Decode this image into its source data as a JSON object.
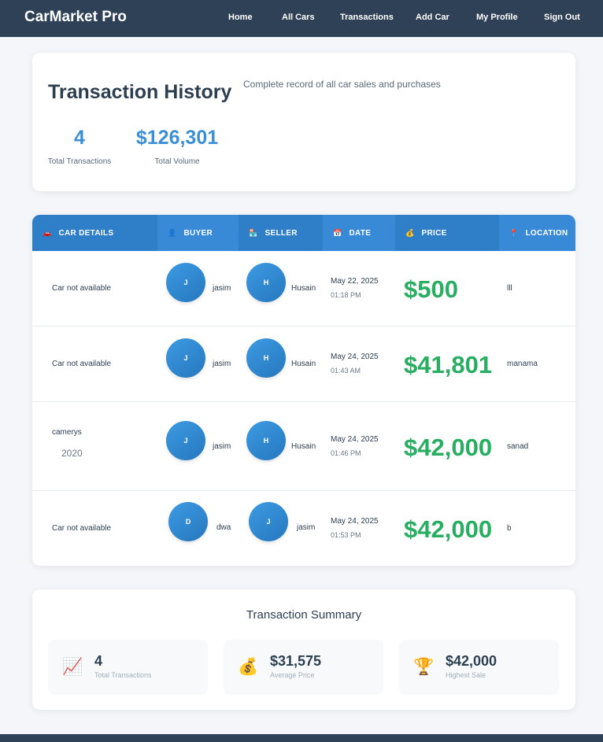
{
  "nav": {
    "brand": "CarMarket Pro",
    "links": [
      "Home",
      "All Cars",
      "Transactions",
      "Add Car",
      "My Profile",
      "Sign Out"
    ]
  },
  "hero": {
    "title": "Transaction History",
    "subtitle": "Complete record of all car sales and purchases",
    "total_transactions": "4",
    "total_transactions_label": "Total Transactions",
    "total_volume": "$126,301",
    "total_volume_label": "Total Volume"
  },
  "table": {
    "columns": [
      {
        "label": "CAR DETAILS",
        "icon": "car-icon",
        "glyph": "🚗"
      },
      {
        "label": "BUYER",
        "icon": "user-icon",
        "glyph": "👤"
      },
      {
        "label": "SELLER",
        "icon": "seller-icon",
        "glyph": "🏪"
      },
      {
        "label": "DATE",
        "icon": "calendar-icon",
        "glyph": "📅"
      },
      {
        "label": "PRICE",
        "icon": "money-bag-icon",
        "glyph": "💰"
      },
      {
        "label": "LOCATION",
        "icon": "pin-icon",
        "glyph": "📍"
      }
    ],
    "rows": [
      {
        "car": "Car not available",
        "year": "",
        "buyer_initial": "J",
        "buyer": "jasim",
        "seller_initial": "H",
        "seller": "Husain",
        "date": "May 22, 2025",
        "time": "01:18 PM",
        "price": "$500",
        "location": "lll"
      },
      {
        "car": "Car not available",
        "year": "",
        "buyer_initial": "J",
        "buyer": "jasim",
        "seller_initial": "H",
        "seller": "Husain",
        "date": "May 24, 2025",
        "time": "01:43 AM",
        "price": "$41,801",
        "location": "manama"
      },
      {
        "car": "camerys",
        "year": "2020",
        "buyer_initial": "J",
        "buyer": "jasim",
        "seller_initial": "H",
        "seller": "Husain",
        "date": "May 24, 2025",
        "time": "01:46 PM",
        "price": "$42,000",
        "location": "sanad"
      },
      {
        "car": "Car not available",
        "year": "",
        "buyer_initial": "D",
        "buyer": "dwa",
        "seller_initial": "J",
        "seller": "jasim",
        "date": "May 24, 2025",
        "time": "01:53 PM",
        "price": "$42,000",
        "location": "b"
      }
    ]
  },
  "summary": {
    "title": "Transaction Summary",
    "items": [
      {
        "icon": "chart-increasing-icon",
        "glyph": "📈",
        "value": "4",
        "label": "Total Transactions"
      },
      {
        "icon": "money-bag-icon",
        "glyph": "💰",
        "value": "$31,575",
        "label": "Average Price"
      },
      {
        "icon": "trophy-icon",
        "glyph": "🏆",
        "value": "$42,000",
        "label": "Highest Sale"
      }
    ]
  }
}
